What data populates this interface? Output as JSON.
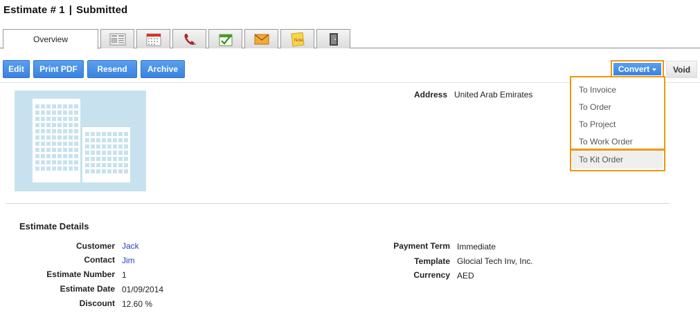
{
  "header": {
    "title": "Estimate # 1",
    "separator": "|",
    "status": "Submitted"
  },
  "tabs": [
    {
      "label": "Overview",
      "icon": "overview"
    },
    {
      "icon": "document-icon"
    },
    {
      "icon": "calendar-icon"
    },
    {
      "icon": "phone-icon"
    },
    {
      "icon": "task-check-icon"
    },
    {
      "icon": "email-icon"
    },
    {
      "icon": "note-icon"
    },
    {
      "icon": "door-exit-icon"
    }
  ],
  "tab_note_text": "Note",
  "toolbar": {
    "edit": "Edit",
    "print_pdf": "Print PDF",
    "resend": "Resend",
    "archive": "Archive",
    "convert": "Convert",
    "void": "Void"
  },
  "convert_menu": {
    "items": [
      "To Invoice",
      "To Order",
      "To Project",
      "To Work Order",
      "To Kit Order"
    ]
  },
  "address": {
    "label": "Address",
    "value": "United Arab Emirates"
  },
  "details": {
    "title": "Estimate Details",
    "left": [
      {
        "label": "Customer",
        "value": "Jack"
      },
      {
        "label": "Contact",
        "value": "Jim"
      },
      {
        "label": "Estimate Number",
        "value": "1"
      },
      {
        "label": "Estimate Date",
        "value": "01/09/2014"
      },
      {
        "label": "Discount",
        "value": "12.60 %"
      }
    ],
    "right": [
      {
        "label": "Payment Term",
        "value": "Immediate"
      },
      {
        "label": "Template",
        "value": "Glocial Tech Inv, Inc."
      },
      {
        "label": "Currency",
        "value": "AED"
      }
    ]
  },
  "colors": {
    "button_blue": "#3a82e0",
    "highlight_orange": "#f0950c",
    "link_blue": "#2a3fbf",
    "image_bg": "#c7e2ee"
  }
}
